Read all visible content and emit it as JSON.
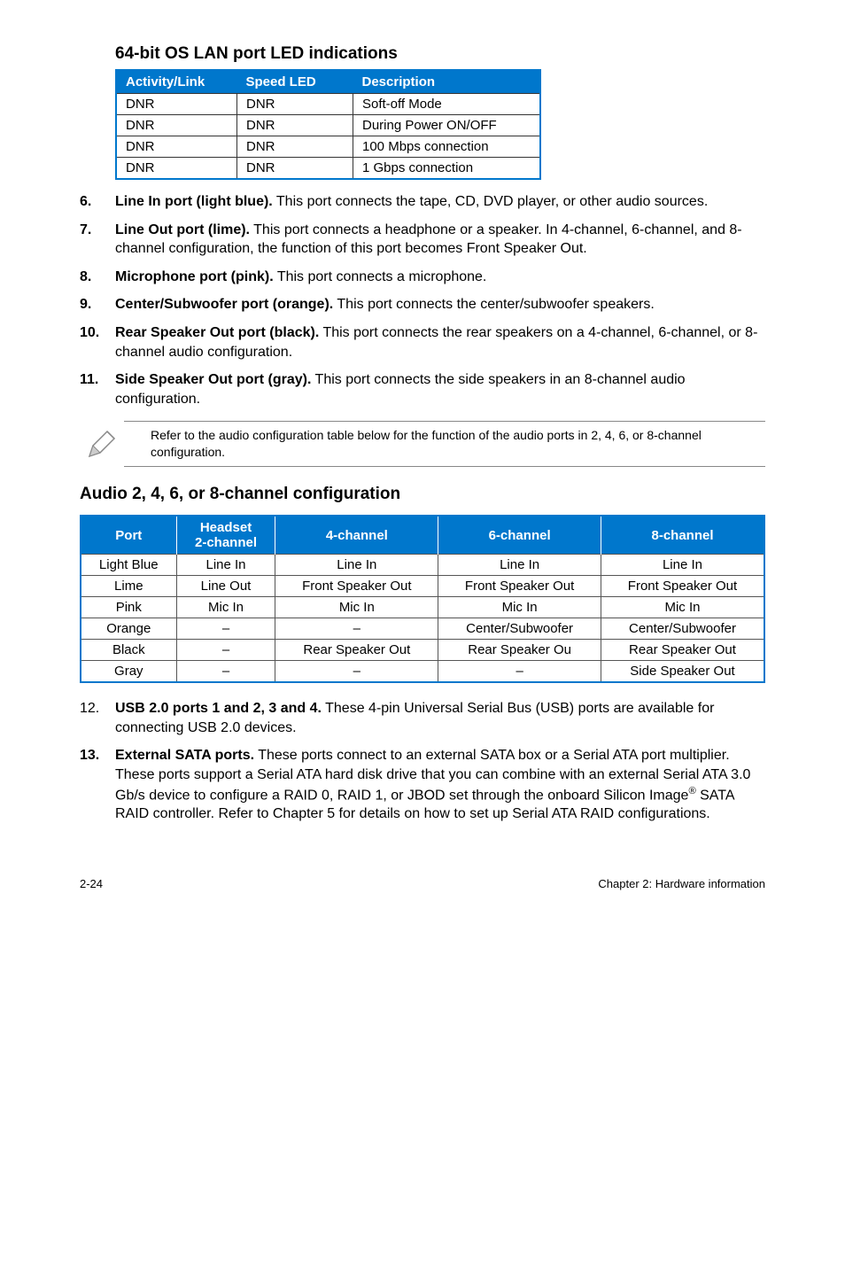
{
  "led_section": {
    "title": "64-bit OS LAN port LED indications",
    "headers": [
      "Activity/Link",
      "Speed LED",
      "Description"
    ],
    "rows": [
      [
        "DNR",
        "DNR",
        "Soft-off Mode"
      ],
      [
        "DNR",
        "DNR",
        "During Power ON/OFF"
      ],
      [
        "DNR",
        "DNR",
        "100 Mbps connection"
      ],
      [
        "DNR",
        "DNR",
        "1 Gbps connection"
      ]
    ]
  },
  "ports_a": [
    {
      "num": "6.",
      "bold": "Line In port (light blue).",
      "rest": " This port connects the tape, CD, DVD player, or other audio sources."
    },
    {
      "num": "7.",
      "bold": "Line Out port (lime).",
      "rest": " This port connects a headphone or a speaker. In 4-channel, 6-channel, and 8-channel configuration, the function of this port becomes Front Speaker Out."
    },
    {
      "num": "8.",
      "bold": "Microphone port (pink).",
      "rest": " This port connects a microphone."
    },
    {
      "num": "9.",
      "bold": "Center/Subwoofer port (orange).",
      "rest": " This port connects the center/subwoofer speakers."
    },
    {
      "num": "10.",
      "bold": "Rear Speaker Out port (black).",
      "rest": " This port connects the rear speakers on a 4-channel, 6-channel, or 8-channel audio configuration."
    },
    {
      "num": "11.",
      "bold": "Side Speaker Out port (gray).",
      "rest": " This port connects the side speakers in an 8-channel audio configuration."
    }
  ],
  "note": "Refer to the audio configuration table below for the function of the audio ports in 2, 4, 6, or 8-channel configuration.",
  "audio_section": {
    "title": "Audio 2, 4, 6, or 8-channel configuration",
    "headers": [
      "Port",
      "Headset 2-channel",
      "4-channel",
      "6-channel",
      "8-channel"
    ],
    "rows": [
      [
        "Light Blue",
        "Line In",
        "Line In",
        "Line In",
        "Line In"
      ],
      [
        "Lime",
        "Line Out",
        "Front Speaker Out",
        "Front Speaker Out",
        "Front Speaker Out"
      ],
      [
        "Pink",
        "Mic In",
        "Mic In",
        "Mic In",
        "Mic In"
      ],
      [
        "Orange",
        "–",
        "–",
        "Center/Subwoofer",
        "Center/Subwoofer"
      ],
      [
        "Black",
        "–",
        "Rear Speaker Out",
        "Rear Speaker Ou",
        "Rear Speaker Out"
      ],
      [
        "Gray",
        "–",
        "–",
        "–",
        "Side Speaker Out"
      ]
    ]
  },
  "ports_b": [
    {
      "num": "12.",
      "bold": "USB 2.0 ports 1 and 2, 3 and 4.",
      "rest": " These 4-pin Universal Serial Bus (USB) ports are available for connecting USB 2.0 devices.",
      "numbold": false
    },
    {
      "num": "13.",
      "bold": "External SATA ports.",
      "rest": " These ports connect to an external SATA box or a Serial ATA port multiplier. These ports support a Serial ATA hard disk drive that you can combine with an external Serial ATA 3.0 Gb/s device to configure a RAID 0, RAID 1, or JBOD set through the onboard Silicon Image",
      "sup": "®",
      "rest2": " SATA RAID controller. Refer to Chapter 5 for details on how to set up Serial ATA RAID configurations.",
      "numbold": true
    }
  ],
  "footer": {
    "left": "2-24",
    "right": "Chapter 2: Hardware information"
  }
}
